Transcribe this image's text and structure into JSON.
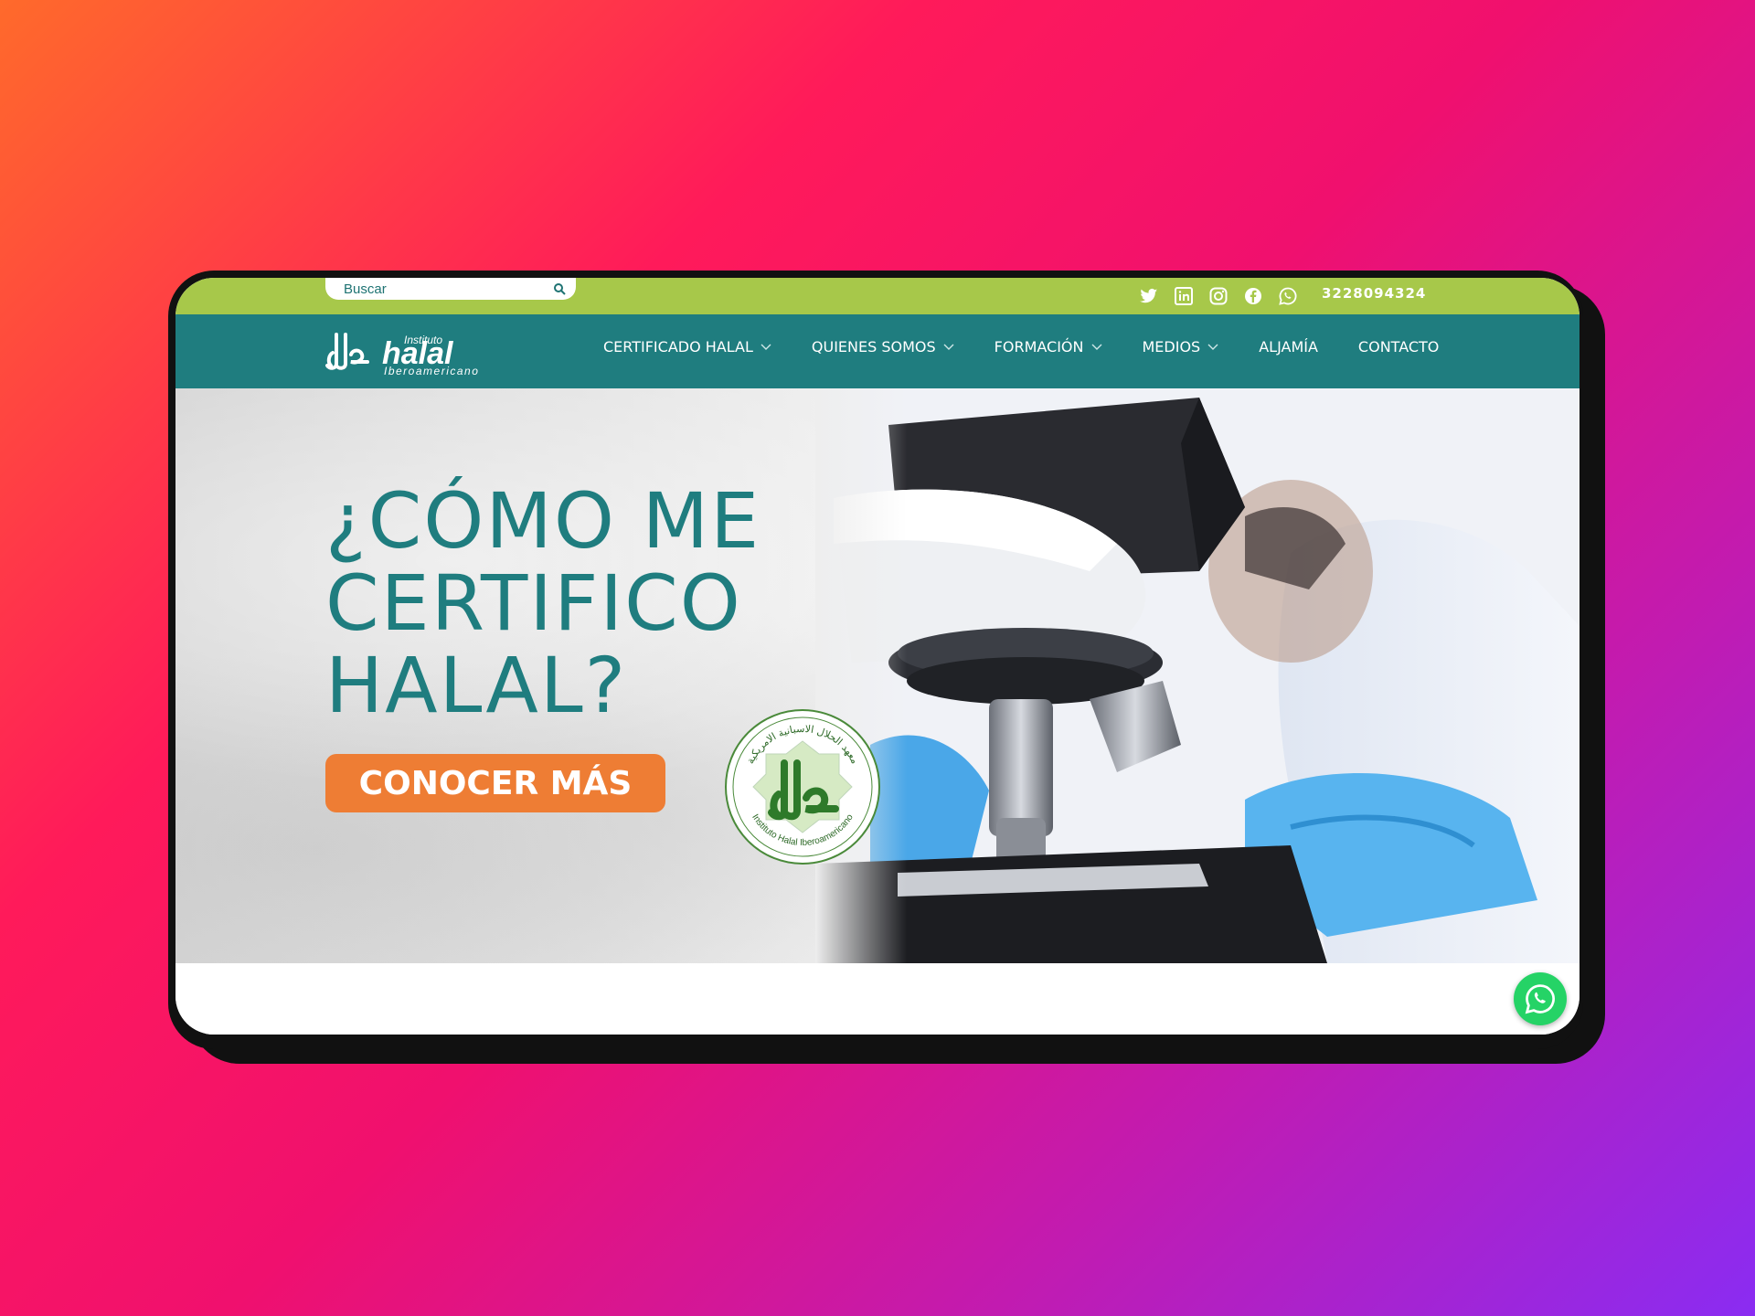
{
  "topbar": {
    "search_placeholder": "Buscar",
    "phone": "3228094324",
    "social_icons": [
      "twitter-icon",
      "linkedin-icon",
      "instagram-icon",
      "facebook-icon",
      "whatsapp-icon"
    ]
  },
  "brand": {
    "logo_top": "Instituto",
    "logo_main": "halal",
    "logo_sub": "Iberoamericano"
  },
  "nav": {
    "items": [
      {
        "label": "CERTIFICADO HALAL",
        "dropdown": true
      },
      {
        "label": "QUIENES SOMOS",
        "dropdown": true
      },
      {
        "label": "FORMACIÓN",
        "dropdown": true
      },
      {
        "label": "MEDIOS",
        "dropdown": true
      },
      {
        "label": "ALJAMÍA",
        "dropdown": false
      },
      {
        "label": "CONTACTO",
        "dropdown": false
      }
    ]
  },
  "hero": {
    "headline": [
      "¿CÓMO ME",
      "CERTIFICO",
      "HALAL?"
    ],
    "cta_label": "CONOCER MÁS",
    "seal_text_arabic": "معهد الحلال الاسبانية الامريكية",
    "seal_text_latin": "Instituto Halal Iberoamericano"
  },
  "colors": {
    "topbar": "#a7c84a",
    "navbar": "#1f7d7f",
    "headline": "#1f7d7f",
    "cta": "#ee7d34",
    "whatsapp": "#25d366"
  }
}
